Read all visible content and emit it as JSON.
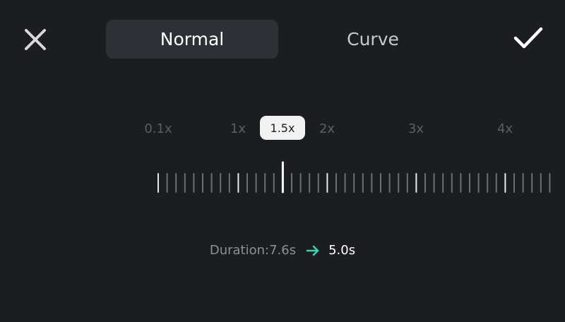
{
  "header": {
    "close_icon": "close-icon",
    "confirm_icon": "check-icon",
    "tabs": [
      {
        "label": "Normal",
        "selected": true
      },
      {
        "label": "Curve",
        "selected": false
      }
    ]
  },
  "speed": {
    "marks": [
      {
        "label": "0.1x",
        "value": 0.1
      },
      {
        "label": "1x",
        "value": 1
      },
      {
        "label": "2x",
        "value": 2
      },
      {
        "label": "3x",
        "value": 3
      },
      {
        "label": "4x",
        "value": 4
      }
    ],
    "current_label": "1.5x",
    "current_value": 1.5,
    "min": 0.1,
    "max": 4.4
  },
  "duration": {
    "label": "Duration:7.6s",
    "new_value": "5.0s",
    "arrow_icon": "arrow-right-icon"
  },
  "colors": {
    "background": "#1b1d20",
    "tab_active": "#2d3034",
    "accent_arrow": "#3ecfb0",
    "tick": "#6b6e72",
    "tick_major": "#e9e9e9"
  }
}
